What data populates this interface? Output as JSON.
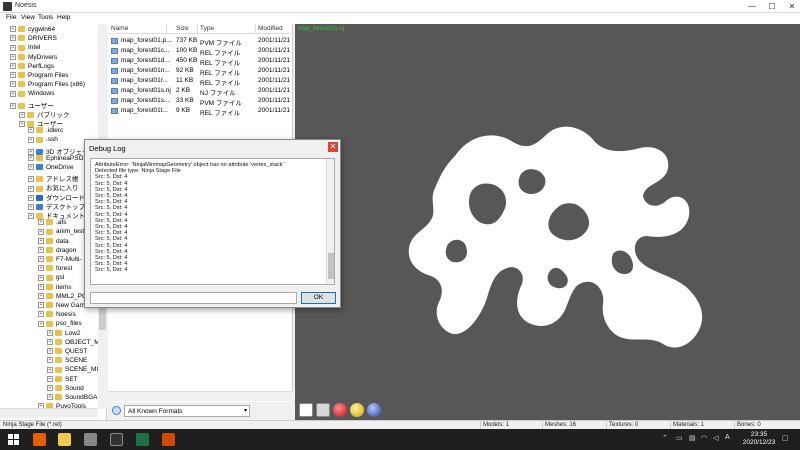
{
  "window": {
    "title": "Noesis",
    "minimize": "—",
    "maximize": "☐",
    "close": "✕"
  },
  "menu": [
    "File",
    "View",
    "Tools",
    "Help"
  ],
  "tree": {
    "items": [
      {
        "label": "cygwin64",
        "level": 1
      },
      {
        "label": "DRIVERS",
        "level": 1
      },
      {
        "label": "Intel",
        "level": 1
      },
      {
        "label": "MyDrivers",
        "level": 1
      },
      {
        "label": "PerfLogs",
        "level": 1
      },
      {
        "label": "Program Files",
        "level": 1
      },
      {
        "label": "Program Files (x86)",
        "level": 1
      },
      {
        "label": "Windows",
        "level": 1
      },
      {
        "label": "ユーザー",
        "level": 1
      },
      {
        "label": "パブリック",
        "level": 2
      },
      {
        "label": "ユーザー",
        "level": 2
      },
      {
        "label": ".idlerc",
        "level": 3
      },
      {
        "label": ".ssh",
        "level": 3
      },
      {
        "label": "3D オブジェクト",
        "level": 3,
        "icon": "blue"
      },
      {
        "label": "EphineaPSO",
        "level": 3
      },
      {
        "label": "OneDrive",
        "level": 3,
        "icon": "blue"
      },
      {
        "label": "アドレス帳",
        "level": 3
      },
      {
        "label": "お気に入り",
        "level": 3
      },
      {
        "label": "ダウンロード",
        "level": 3,
        "icon": "dl"
      },
      {
        "label": "デスクトップ",
        "level": 3,
        "icon": "blue"
      },
      {
        "label": "ドキュメント",
        "level": 3
      },
      {
        "label": ".afs",
        "level": 4
      },
      {
        "label": "anim_test",
        "level": 4
      },
      {
        "label": "data",
        "level": 4
      },
      {
        "label": "dragon",
        "level": 4
      },
      {
        "label": "F7-Multi-",
        "level": 4
      },
      {
        "label": "forest",
        "level": 4
      },
      {
        "label": "gsl",
        "level": 4
      },
      {
        "label": "items",
        "level": 4
      },
      {
        "label": "MML2_PC",
        "level": 4
      },
      {
        "label": "New Gam",
        "level": 4
      },
      {
        "label": "Noesis",
        "level": 4
      },
      {
        "label": "pso_files",
        "level": 4
      },
      {
        "label": "Low2",
        "level": 5
      },
      {
        "label": "OBJECT_M",
        "level": 5
      },
      {
        "label": "QUEST",
        "level": 5
      },
      {
        "label": "SCENE",
        "level": 5
      },
      {
        "label": "SCENE_MI",
        "level": 5
      },
      {
        "label": "SET",
        "level": 5
      },
      {
        "label": "Sound",
        "level": 5
      },
      {
        "label": "SoundBGA",
        "level": 5
      },
      {
        "label": "PuyoTools",
        "level": 4
      }
    ]
  },
  "filelist": {
    "columns": [
      "Name",
      "Size",
      "Type",
      "Modified"
    ],
    "rows": [
      {
        "name": "map_forest01.p...",
        "size": "737 KB",
        "type": "PVM ファイル",
        "modified": "2001/11/21"
      },
      {
        "name": "map_forest01c...",
        "size": "100 KB",
        "type": "REL ファイル",
        "modified": "2001/11/21"
      },
      {
        "name": "map_forest01d...",
        "size": "450 KB",
        "type": "REL ファイル",
        "modified": "2001/11/21"
      },
      {
        "name": "map_forest01n...",
        "size": "92 KB",
        "type": "REL ファイル",
        "modified": "2001/11/21"
      },
      {
        "name": "map_forest01r...",
        "size": "11 KB",
        "type": "REL ファイル",
        "modified": "2001/11/21"
      },
      {
        "name": "map_forest01s.nj",
        "size": "2 KB",
        "type": "NJ ファイル",
        "modified": "2001/11/21"
      },
      {
        "name": "map_forest01s...",
        "size": "33 KB",
        "type": "PVM ファイル",
        "modified": "2001/11/21"
      },
      {
        "name": "map_forest01t...",
        "size": "9 KB",
        "type": "REL ファイル",
        "modified": "2001/11/21"
      }
    ]
  },
  "format_filter": {
    "value": "All Known Formats"
  },
  "viewport": {
    "label": "map_forest01s.nj"
  },
  "dialog": {
    "title": "Debug Log",
    "close": "✕",
    "lines": [
      "AttributeError: 'NinjaMinimapGeometry' object has no attribute 'vertex_stack'",
      "Detected file type: Ninja Stage File",
      "Src: 5, Dst: 4",
      "Src: 5, Dst: 4",
      "Src: 5, Dst: 4",
      "Src: 5, Dst: 4",
      "Src: 5, Dst: 4",
      "Src: 5, Dst: 4",
      "Src: 5, Dst: 4",
      "Src: 5, Dst: 4",
      "Src: 5, Dst: 4",
      "Src: 5, Dst: 4",
      "Src: 5, Dst: 4",
      "Src: 5, Dst: 4",
      "Src: 5, Dst: 4",
      "Src: 5, Dst: 4",
      "Src: 5, Dst: 4",
      "Src: 5, Dst: 4"
    ],
    "input_value": "",
    "ok_label": "OK"
  },
  "status": {
    "file_type": "Ninja Stage File (*.rel)",
    "models": "Models: 1",
    "meshes": "Meshes: 16",
    "textures": "Textures: 0",
    "materials": "Materials: 1",
    "bones": "Bones: 0"
  },
  "taskbar": {
    "time": "23:35",
    "date": "2020/12/23",
    "ime": "A",
    "colors": {
      "firefox": "#e66000",
      "explorer": "#f2c94c",
      "noesis": "#888888",
      "terminal": "#333333",
      "excel": "#1e7145",
      "extra": "#d04a02"
    }
  }
}
